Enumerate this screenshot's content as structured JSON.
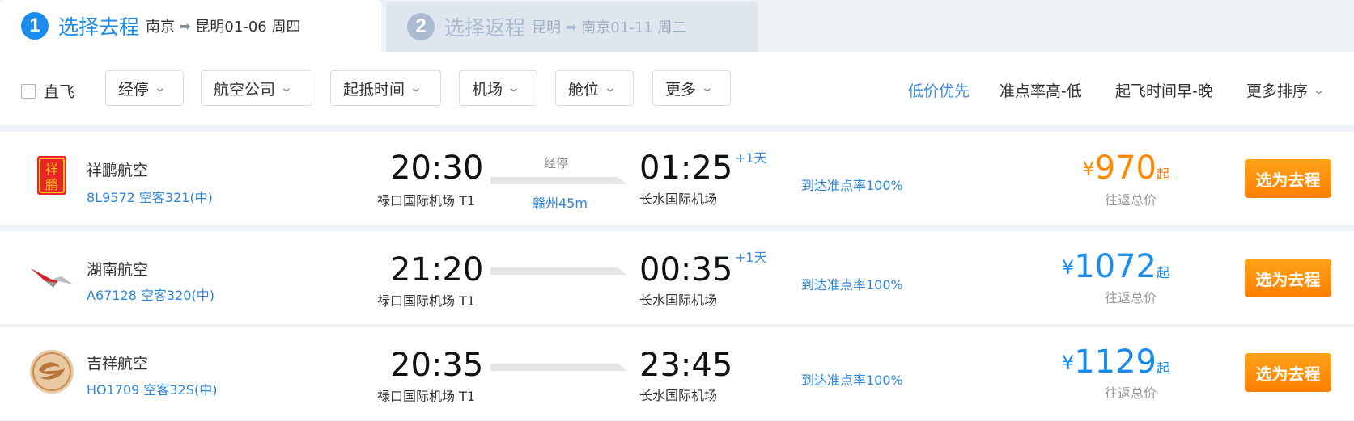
{
  "steps": [
    {
      "num": "1",
      "title": "选择去程",
      "from": "南京",
      "to": "昆明",
      "date": "01-06 周四"
    },
    {
      "num": "2",
      "title": "选择返程",
      "from": "昆明",
      "to": "南京",
      "date": "01-11 周二"
    }
  ],
  "filters": {
    "direct_label": "直飞",
    "buttons": [
      "经停",
      "航空公司",
      "起抵时间",
      "机场",
      "舱位",
      "更多"
    ],
    "sorts": [
      "低价优先",
      "准点率高-低",
      "起飞时间早-晚",
      "更多排序"
    ]
  },
  "flights": [
    {
      "airline": "祥鹏航空",
      "flight_no": "8L9572 空客321(中)",
      "dep_time": "20:30",
      "dep_airport": "禄口国际机场 T1",
      "arr_time": "01:25",
      "arr_airport": "长水国际机场",
      "plus_day": "+1天",
      "stop_label": "经停",
      "stop_city": "赣州45m",
      "ontime": "到达准点率100%",
      "currency": "¥",
      "price": "970",
      "price_suffix": "起",
      "price_note": "往返总价",
      "select_label": "选为去程",
      "logo_text": "祥鹏"
    },
    {
      "airline": "湖南航空",
      "flight_no": "A67128 空客320(中)",
      "dep_time": "21:20",
      "dep_airport": "禄口国际机场 T1",
      "arr_time": "00:35",
      "arr_airport": "长水国际机场",
      "plus_day": "+1天",
      "ontime": "到达准点率100%",
      "currency": "¥",
      "price": "1072",
      "price_suffix": "起",
      "price_note": "往返总价",
      "select_label": "选为去程"
    },
    {
      "airline": "吉祥航空",
      "flight_no": "HO1709 空客32S(中)",
      "dep_time": "20:35",
      "dep_airport": "禄口国际机场 T1",
      "arr_time": "23:45",
      "arr_airport": "长水国际机场",
      "ontime": "到达准点率100%",
      "currency": "¥",
      "price": "1129",
      "price_suffix": "起",
      "price_note": "往返总价",
      "select_label": "选为去程"
    }
  ],
  "colors": {
    "accent": "#1a8cf0",
    "orange_price": "#ff8a00",
    "button_gradient_top": "#ffa418",
    "button_gradient_bottom": "#ff7e00"
  },
  "icons": {
    "route_arrow": "arrow-right-icon",
    "chevron": "chevron-down-icon"
  }
}
